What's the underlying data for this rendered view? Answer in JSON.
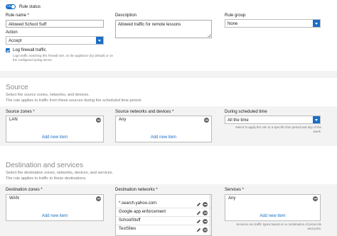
{
  "rule_status": {
    "label": "Rule status",
    "toggle_text": "ON"
  },
  "rule_name": {
    "label": "Rule name *",
    "value": "Allowed School Suff"
  },
  "description": {
    "label": "Description",
    "value": "Allowed traffic for remote lessons"
  },
  "rule_group": {
    "label": "Rule group",
    "selected": "None"
  },
  "action": {
    "label": "Action",
    "selected": "Accept"
  },
  "log_traffic": {
    "label": "Log firewall traffic",
    "hint": "Logs traffic matching this firewall rule, on the appliance (by default) or on the configured syslog server."
  },
  "source": {
    "title": "Source",
    "desc1": "Select the source zones, networks, and devices.",
    "desc2": "The rule applies to traffic from these sources during the scheduled time period.",
    "zones": {
      "label": "Source zones *",
      "items": [
        "LAN"
      ],
      "add": "Add new item"
    },
    "networks": {
      "label": "Source networks and devices *",
      "items": [
        "Any"
      ],
      "add": "Add new item"
    },
    "schedule": {
      "label": "During scheduled time",
      "selected": "All the time",
      "hint": "Select to apply the rule to a specific time period and day of the week."
    }
  },
  "destination": {
    "title": "Destination and services",
    "desc1": "Select the destination zones, networks, devices, and services.",
    "desc2": "The rule applies to traffic to these destinations.",
    "zones": {
      "label": "Destination zones *",
      "items": [
        "WAN"
      ],
      "add": "Add new item"
    },
    "networks": {
      "label": "Destination networks *",
      "items": [
        "*.search.yahoo.com",
        "Google app enforcement",
        "SchoolStuff",
        "TestSites"
      ]
    },
    "services": {
      "label": "Services *",
      "items": [
        "Any"
      ],
      "add": "Add new item",
      "hint": "Services are traffic types based on a combination of protocols and ports."
    }
  }
}
